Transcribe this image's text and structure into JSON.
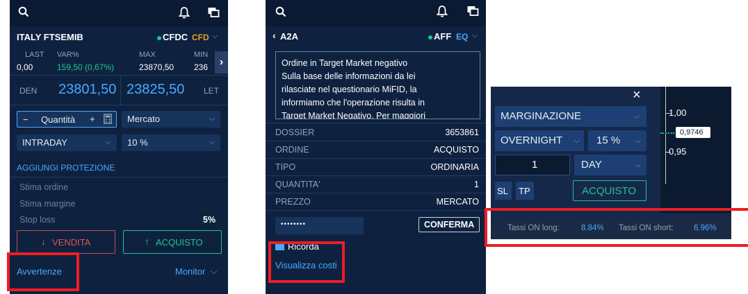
{
  "left_panel": {
    "instrument": "ITALY FTSEMIB",
    "market": "CFDC",
    "type_badge": "CFD",
    "stats": [
      {
        "label": "LAST",
        "value": "0,00"
      },
      {
        "label": "VAR%",
        "value": "159,50 (0,67%)"
      },
      {
        "label": "MAX",
        "value": "23870,50"
      },
      {
        "label": "MIN",
        "value": "236"
      }
    ],
    "bid_label": "DEN",
    "bid_price": "23801,50",
    "ask_price": "23825,50",
    "ask_label": "LET",
    "quantity_minus": "−",
    "quantity_label": "Quantità",
    "quantity_plus": "+",
    "order_type": "Mercato",
    "duration": "INTRADAY",
    "margin": "10 %",
    "add_protection": "AGGIUNGI PROTEZIONE",
    "estimate_order": "Stima ordine",
    "estimate_margin": "Stima margine",
    "stop_loss_label": "Stop loss",
    "stop_loss_value": "5%",
    "sell_button": "VENDITA",
    "buy_button": "ACQUISTO",
    "warnings_link": "Avvertenze",
    "monitor_link": "Monitor"
  },
  "mid_panel": {
    "back_label": "A2A",
    "market": "AFF",
    "type_badge": "EQ",
    "message_lines": [
      "Ordine in Target Market negativo",
      "Sulla base delle informazioni da lei",
      "rilasciate nel questionario MiFID, la",
      "informiamo che l'operazione risulta in",
      "Target Market Negativo. Per maggiori"
    ],
    "rows": [
      {
        "label": "DOSSIER",
        "value": "3653861"
      },
      {
        "label": "ORDINE",
        "value": "ACQUISTO"
      },
      {
        "label": "TIPO",
        "value": "ORDINARIA"
      },
      {
        "label": "QUANTITA'",
        "value": "1"
      },
      {
        "label": "PREZZO",
        "value": "MERCATO"
      }
    ],
    "password_mask": "••••••••",
    "confirm_button": "CONFERMA",
    "remember_label": "Ricorda",
    "view_costs_link": "Visualizza costi"
  },
  "right_panel": {
    "close_glyph": "×",
    "mode": "MARGINAZIONE",
    "duration": "OVERNIGHT",
    "leverage": "15 %",
    "quantity": "1",
    "validity": "DAY",
    "sl_button": "SL",
    "tp_button": "TP",
    "buy_button": "ACQUISTO",
    "axis_labels": [
      "1,00",
      "0,95"
    ],
    "price_tag": "0,9746",
    "rates_long_label": "Tassi ON long:",
    "rates_long_value": "8.84%",
    "rates_short_label": "Tassi ON short:",
    "rates_short_value": "6.96%"
  },
  "icons": [
    "search-icon",
    "bell-icon",
    "windows-icon",
    "chevron-down-icon",
    "chevron-right-icon",
    "calculator-icon",
    "arrow-down-icon",
    "arrow-up-icon",
    "close-icon"
  ],
  "colors": {
    "panel": "#0e2240",
    "topbar": "#0a1a33",
    "green": "#22c58a",
    "blue": "#4aa8ff",
    "orange": "#f0a020",
    "red": "#e04a4a",
    "highlight": "#ee1c24"
  }
}
